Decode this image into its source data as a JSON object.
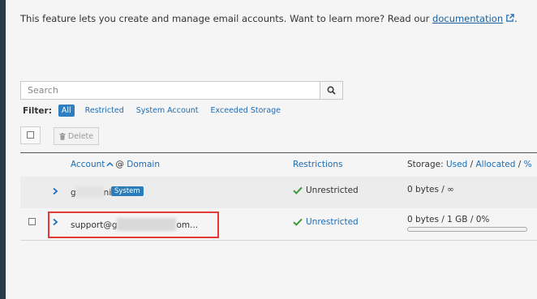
{
  "intro": {
    "text": "This feature lets you create and manage email accounts. Want to learn more? Read our ",
    "link_label": "documentation",
    "link_icon": "external-link-icon",
    "suffix": "."
  },
  "search": {
    "placeholder": "Search",
    "value": "",
    "button_icon": "search-icon"
  },
  "filters": {
    "label": "Filter:",
    "options": [
      "All",
      "Restricted",
      "System Account",
      "Exceeded Storage"
    ],
    "selected": "All"
  },
  "toolbar": {
    "delete_label": "Delete",
    "delete_icon": "trash-icon"
  },
  "table": {
    "headers": {
      "account": "Account",
      "at_sign": "@",
      "domain": "Domain",
      "restrictions": "Restrictions",
      "storage_prefix": "Storage:",
      "used": "Used",
      "sep1": "/",
      "allocated": "Allocated",
      "sep2": "/",
      "percent": "%"
    },
    "rows": [
      {
        "account_start": "g",
        "account_end": "ni",
        "badge": "System",
        "restriction": "Unrestricted",
        "storage": "0 bytes / ∞"
      },
      {
        "account_start": "support@g",
        "account_end": "om...",
        "restriction": "Unrestricted",
        "storage": "0 bytes / 1 GB / 0%",
        "usage_fraction": 0
      }
    ]
  },
  "colors": {
    "accent": "#2f7ec1",
    "link": "#1b6cb6",
    "success_check": "#3c9a3c",
    "highlight_border": "#e53935",
    "sidebar": "#293a4a"
  }
}
